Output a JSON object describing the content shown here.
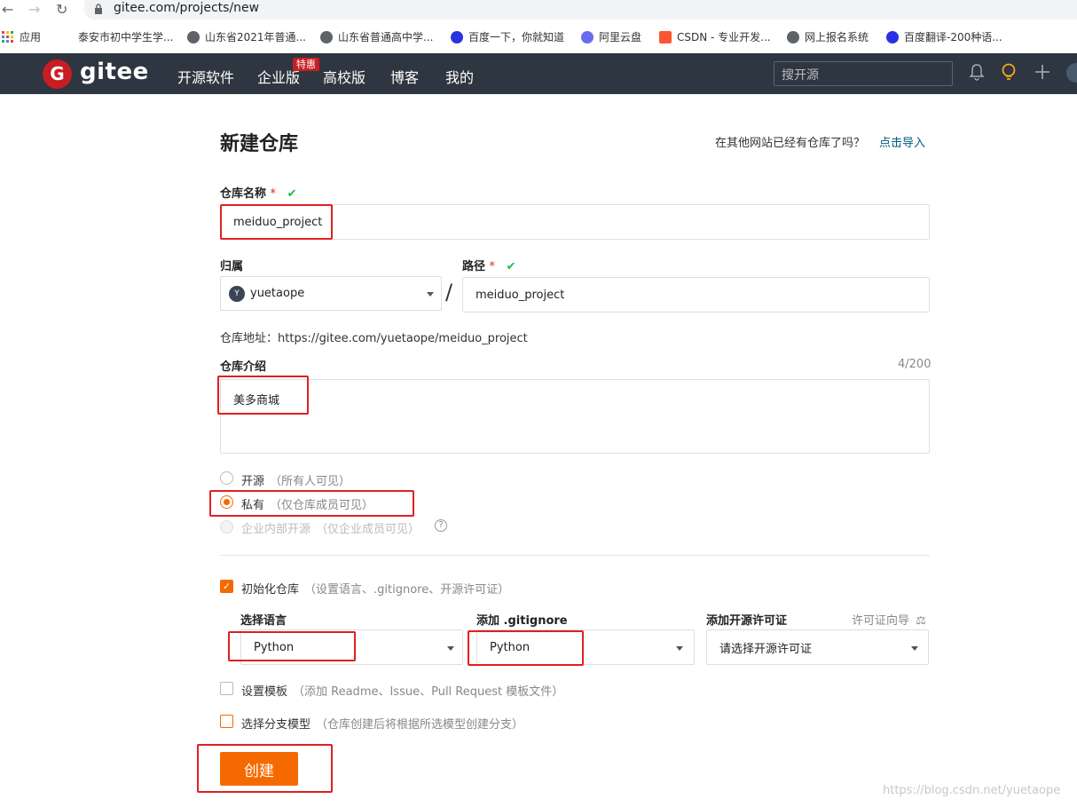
{
  "browser": {
    "url": "gitee.com/projects/new",
    "bookmarks": [
      {
        "label": "应用",
        "color": "#e94235"
      },
      {
        "label": "泰安市初中学生学...",
        "color": ""
      },
      {
        "label": "山东省2021年普通...",
        "color": "#5f6368"
      },
      {
        "label": "山东省普通高中学...",
        "color": "#5f6368"
      },
      {
        "label": "百度一下，你就知道",
        "color": "#2932e1"
      },
      {
        "label": "阿里云盘",
        "color": "#6b6bf0"
      },
      {
        "label": "CSDN - 专业开发...",
        "color": "#fc5531"
      },
      {
        "label": "网上报名系统",
        "color": "#5f6368"
      },
      {
        "label": "百度翻译-200种语...",
        "color": "#2932e1"
      }
    ]
  },
  "header": {
    "logo_letter": "G",
    "logo_text": "gitee",
    "nav": [
      "开源软件",
      "企业版",
      "高校版",
      "博客",
      "我的"
    ],
    "badge": "特惠",
    "search_placeholder": "搜开源"
  },
  "form": {
    "title": "新建仓库",
    "import_question": "在其他网站已经有仓库了吗？",
    "import_link": "点击导入",
    "name_label": "仓库名称",
    "name_value": "meiduo_project",
    "owner_label": "归属",
    "owner_avatar": "Y",
    "owner_value": "yuetaope",
    "path_label": "路径",
    "path_value": "meiduo_project",
    "address_label": "仓库地址：",
    "address_value": "https://gitee.com/yuetaope/meiduo_project",
    "intro_label": "仓库介绍",
    "intro_count": "4/200",
    "intro_value": "美多商城",
    "visibility": [
      {
        "label": "开源",
        "hint": "（所有人可见）",
        "state": "off"
      },
      {
        "label": "私有",
        "hint": "（仅仓库成员可见）",
        "state": "on"
      },
      {
        "label": "企业内部开源",
        "hint": "（仅企业成员可见）",
        "state": "disabled"
      }
    ],
    "init_label": "初始化仓库",
    "init_hint": "（设置语言、.gitignore、开源许可证）",
    "lang_label": "选择语言",
    "lang_value": "Python",
    "gitignore_label": "添加 .gitignore",
    "gitignore_value": "Python",
    "license_label": "添加开源许可证",
    "license_guide": "许可证向导",
    "license_placeholder": "请选择开源许可证",
    "template_label": "设置模板",
    "template_hint": "（添加 Readme、Issue、Pull Request 模板文件）",
    "branch_label": "选择分支模型",
    "branch_hint": "（仓库创建后将根据所选模型创建分支）",
    "submit": "创建"
  },
  "watermark": "https://blog.csdn.net/yuetaope"
}
